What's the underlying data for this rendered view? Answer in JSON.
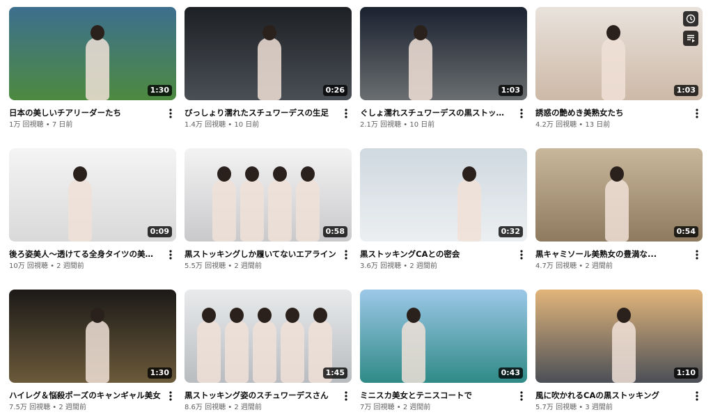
{
  "icons": {
    "more": "more-vert-icon",
    "watch_later": "clock-icon",
    "queue": "add-to-queue-icon"
  },
  "videos": [
    {
      "title": "日本の美しいチアリーダーたち",
      "views": "1万 回視聴",
      "age": "7 日前",
      "duration": "1:30",
      "palette": [
        "#3d6f8f",
        "#4d8a3f"
      ]
    },
    {
      "title": "びっしょり濡れたスチュワーデスの生足",
      "views": "1.4万 回視聴",
      "age": "10 日前",
      "duration": "0:26",
      "palette": [
        "#1d2024",
        "#4a4f55"
      ]
    },
    {
      "title": "ぐしょ濡れスチュワーデスの黒ストッキング",
      "views": "2.1万 回視聴",
      "age": "10 日前",
      "duration": "1:03",
      "palette": [
        "#1b2230",
        "#6a6e70"
      ]
    },
    {
      "title": "誘惑の艶めき美熟女たち",
      "views": "4.2万 回視聴",
      "age": "13 日前",
      "duration": "1:03",
      "palette": [
        "#e9e2dc",
        "#cdb9a7"
      ]
    },
    {
      "title": "後ろ姿美人～透けてる全身タイツの美女～",
      "views": "10万 回視聴",
      "age": "2 週間前",
      "duration": "0:09",
      "palette": [
        "#f4f4f4",
        "#d9d9d9"
      ]
    },
    {
      "title": "黒ストッキングしか履いてないエアライン",
      "views": "5.5万 回視聴",
      "age": "2 週間前",
      "duration": "0:58",
      "palette": [
        "#f3f3f3",
        "#c9c9cc"
      ]
    },
    {
      "title": "黒ストッキングCAとの密会",
      "views": "3.6万 回視聴",
      "age": "2 週間前",
      "duration": "0:32",
      "palette": [
        "#cfd9e0",
        "#eceff1"
      ]
    },
    {
      "title": "黒キャミソール美熟女の豊満な...",
      "views": "4.7万 回視聴",
      "age": "2 週間前",
      "duration": "0:54",
      "palette": [
        "#c9b79c",
        "#8e7a5f"
      ]
    },
    {
      "title": "ハイレグ＆悩殺ポーズのキャンギャル美女",
      "views": "7.5万 回視聴",
      "age": "2 週間前",
      "duration": "1:30",
      "palette": [
        "#1c1a18",
        "#6b5a3a"
      ]
    },
    {
      "title": "黒ストッキング姿のスチュワーデスさん",
      "views": "8.6万 回視聴",
      "age": "2 週間前",
      "duration": "1:45",
      "palette": [
        "#e8eaec",
        "#b9bcbf"
      ]
    },
    {
      "title": "ミニスカ美女とテニスコートで",
      "views": "7万 回視聴",
      "age": "2 週間前",
      "duration": "0:43",
      "palette": [
        "#9cc8e8",
        "#2f8a86"
      ]
    },
    {
      "title": "風に吹かれるCAの黒ストッキング",
      "views": "5.7万 回視聴",
      "age": "3 週間前",
      "duration": "1:10",
      "palette": [
        "#e2b57a",
        "#4b4f57"
      ]
    }
  ]
}
